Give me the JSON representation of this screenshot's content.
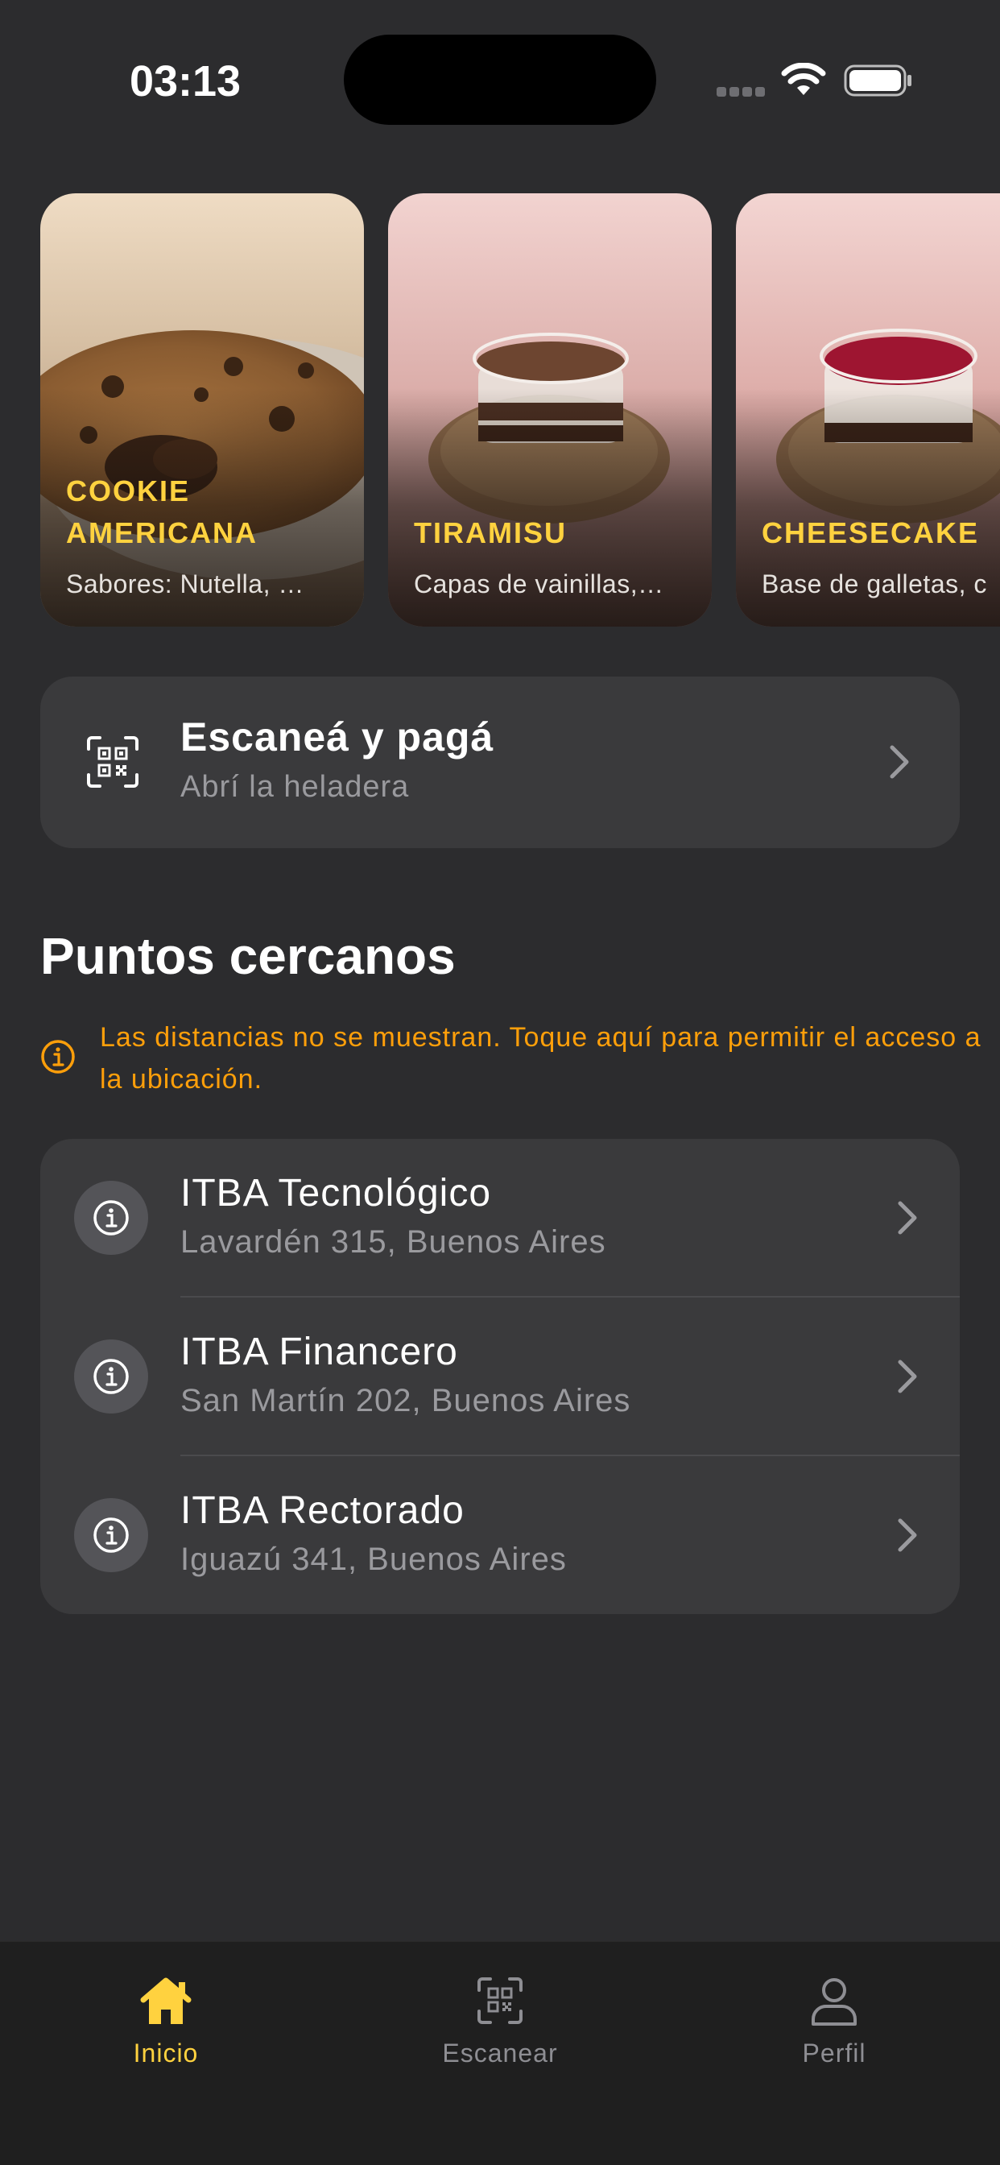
{
  "status_bar": {
    "time": "03:13"
  },
  "products": [
    {
      "name": "COOKIE AMERICANA",
      "description": "Sabores: Nutella, …"
    },
    {
      "name": "TIRAMISU",
      "description": "Capas de vainillas,…"
    },
    {
      "name": "CHEESECAKE",
      "description": "Base de galletas, c"
    }
  ],
  "scan_card": {
    "title": "Escaneá y pagá",
    "subtitle": "Abrí la heladera"
  },
  "nearby": {
    "title": "Puntos cercanos",
    "notice": "Las distancias no se muestran. Toque aquí para permitir el acceso a la ubicación.",
    "locations": [
      {
        "name": "ITBA Tecnológico",
        "address": "Lavardén 315, Buenos Aires"
      },
      {
        "name": "ITBA Financero",
        "address": "San Martín 202, Buenos Aires"
      },
      {
        "name": "ITBA Rectorado",
        "address": "Iguazú 341, Buenos Aires"
      }
    ]
  },
  "tabs": [
    {
      "label": "Inicio",
      "icon": "home-icon",
      "active": true
    },
    {
      "label": "Escanear",
      "icon": "qr-scan-icon",
      "active": false
    },
    {
      "label": "Perfil",
      "icon": "person-icon",
      "active": false
    }
  ],
  "colors": {
    "background": "#2c2c2e",
    "card": "#3a3a3c",
    "accent": "#ffd23f",
    "warning": "#ff9f0a",
    "secondary_text": "#9a9a9e"
  }
}
